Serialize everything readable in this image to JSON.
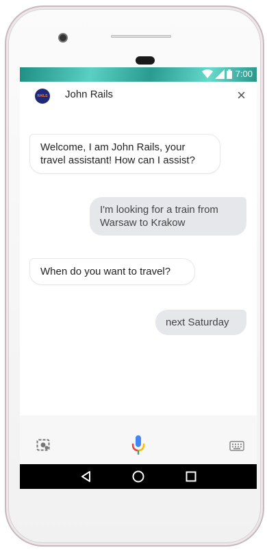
{
  "status_bar": {
    "time": "7:00"
  },
  "header": {
    "avatar_text": "RAILS",
    "title": "John Rails",
    "close_glyph": "×"
  },
  "messages": [
    {
      "sender": "bot",
      "text": "Welcome, I am John Rails, your travel assistant! How can I assist?"
    },
    {
      "sender": "user",
      "text": "I'm looking for a train from Warsaw to Krakow"
    },
    {
      "sender": "bot",
      "text": "When do you want to travel?"
    },
    {
      "sender": "user",
      "text": "next Saturday"
    }
  ],
  "input_bar": {
    "left_icon": "lens-icon",
    "center_icon": "microphone-icon",
    "right_icon": "keyboard-icon"
  },
  "nav_bar": {
    "buttons": [
      "back-icon",
      "home-icon",
      "recents-icon"
    ]
  },
  "colors": {
    "status_bar": "#3fb8aa",
    "user_bubble": "#e6e7eb",
    "mic_blue": "#4285f4",
    "mic_red": "#ea4335",
    "mic_yellow": "#fbbc05",
    "mic_green": "#34a853"
  }
}
